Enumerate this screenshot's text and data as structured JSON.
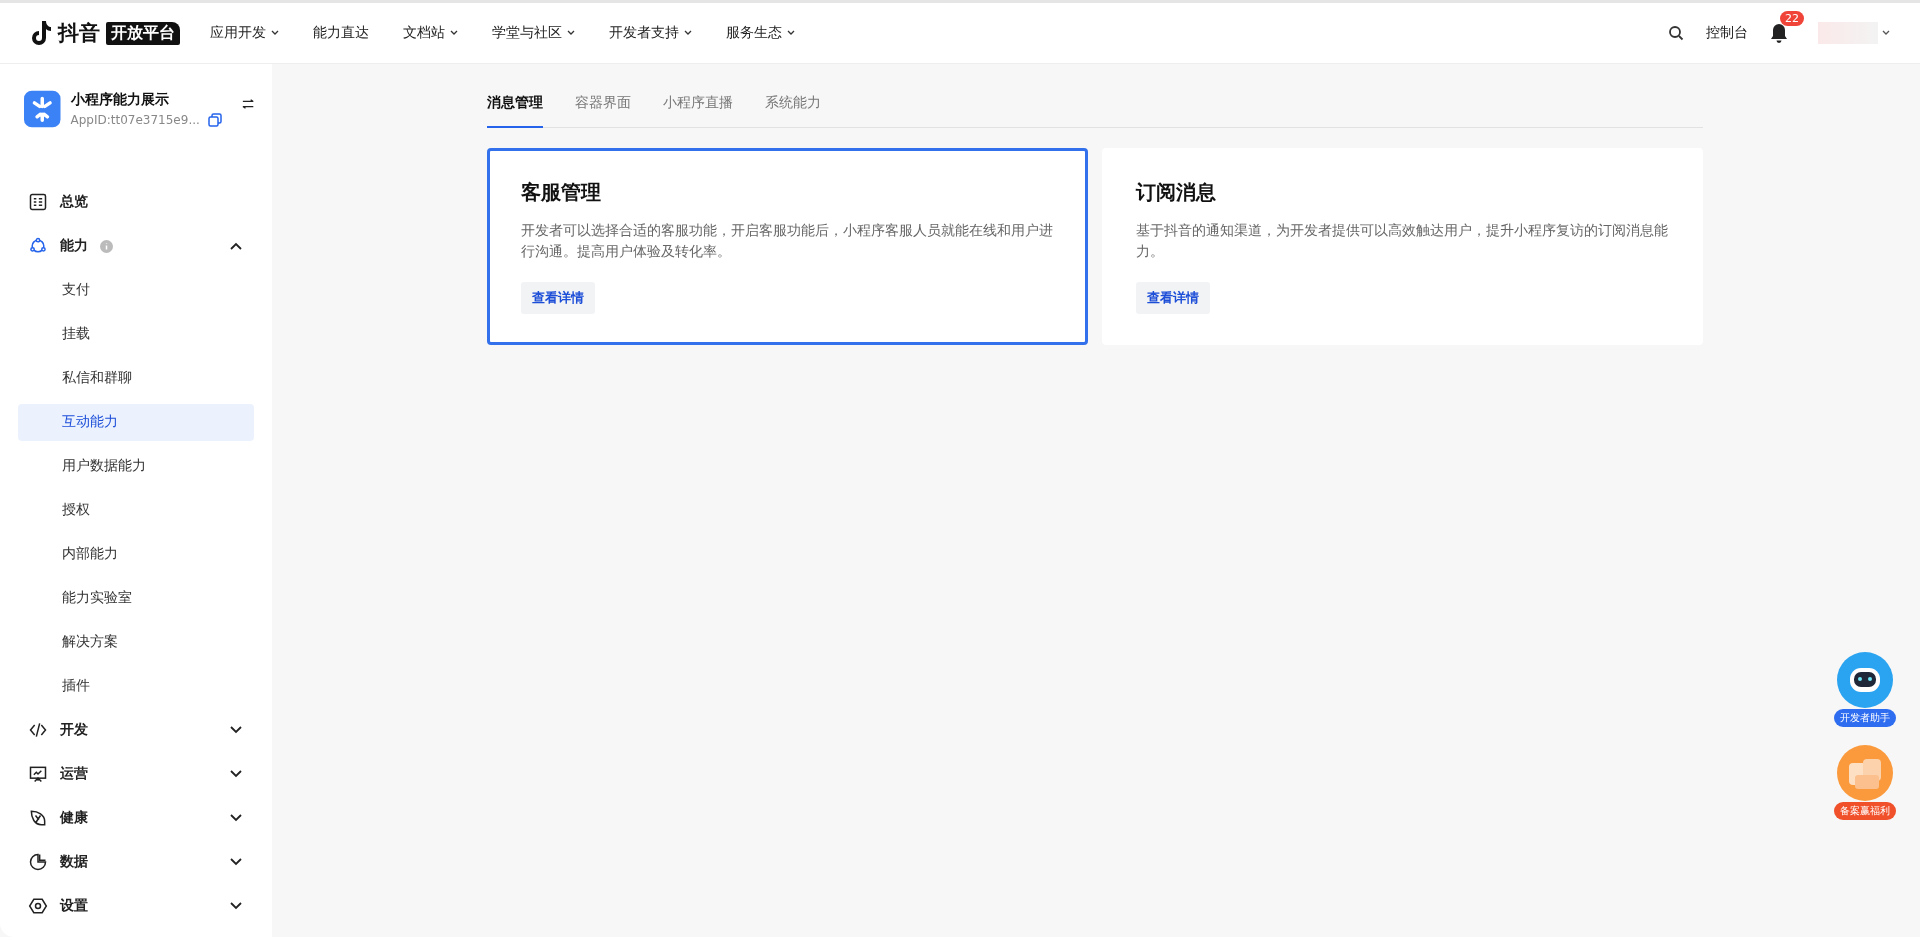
{
  "brand": {
    "name": "抖音",
    "tag": "开放平台"
  },
  "top_nav": [
    {
      "label": "应用开发",
      "dropdown": true
    },
    {
      "label": "能力直达",
      "dropdown": false
    },
    {
      "label": "文档站",
      "dropdown": true
    },
    {
      "label": "学堂与社区",
      "dropdown": true
    },
    {
      "label": "开发者支持",
      "dropdown": true
    },
    {
      "label": "服务生态",
      "dropdown": true
    }
  ],
  "top_right": {
    "console": "控制台",
    "notifications": "22"
  },
  "app": {
    "name": "小程序能力展示",
    "app_id": "AppID:tt07e3715e9..."
  },
  "sidebar": [
    {
      "label": "总览",
      "info": false,
      "selected": false
    },
    {
      "label": "能力",
      "info": true,
      "expanded": true,
      "children": [
        {
          "label": "支付",
          "selected": false
        },
        {
          "label": "挂载",
          "selected": false
        },
        {
          "label": "私信和群聊",
          "selected": false
        },
        {
          "label": "互动能力",
          "selected": true
        },
        {
          "label": "用户数据能力",
          "selected": false
        },
        {
          "label": "授权",
          "selected": false
        },
        {
          "label": "内部能力",
          "selected": false
        },
        {
          "label": "能力实验室",
          "selected": false
        },
        {
          "label": "解决方案",
          "selected": false
        },
        {
          "label": "插件",
          "selected": false
        }
      ]
    },
    {
      "label": "开发",
      "info": false,
      "expanded": false
    },
    {
      "label": "运营",
      "info": false,
      "expanded": false
    },
    {
      "label": "健康",
      "info": false,
      "expanded": false
    },
    {
      "label": "数据",
      "info": false,
      "expanded": false
    },
    {
      "label": "设置",
      "info": false,
      "expanded": false
    }
  ],
  "tabs": [
    {
      "label": "消息管理",
      "selected": true
    },
    {
      "label": "容器界面",
      "selected": false
    },
    {
      "label": "小程序直播",
      "selected": false
    },
    {
      "label": "系统能力",
      "selected": false
    }
  ],
  "cards": [
    {
      "title": "客服管理",
      "description": "开发者可以选择合适的客服功能，开启客服功能后，小程序客服人员就能在线和用户进行沟通。提高用户体验及转化率。",
      "button": "查看详情",
      "selected": true
    },
    {
      "title": "订阅消息",
      "description": "基于抖音的通知渠道，为开发者提供可以高效触达用户，提升小程序复访的订阅消息能力。",
      "button": "查看详情",
      "selected": false
    }
  ],
  "floating": [
    {
      "label": "开发者助手",
      "kind": "assistant"
    },
    {
      "label": "备案赢福利",
      "kind": "gift"
    }
  ]
}
